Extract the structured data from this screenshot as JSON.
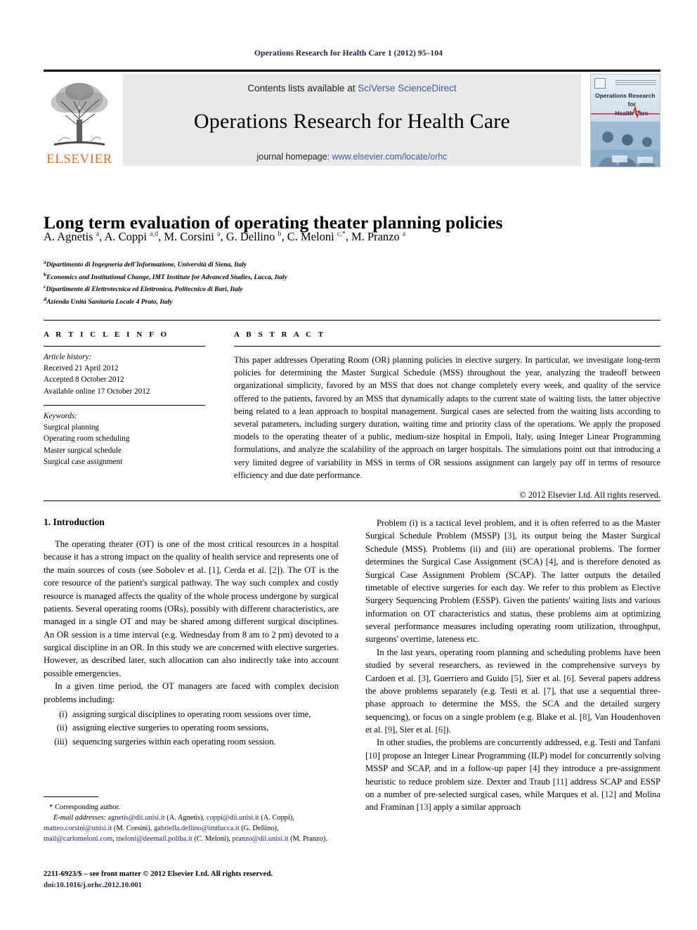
{
  "running_head": "Operations Research for Health Care 1 (2012) 95–104",
  "masthead": {
    "contents_prefix": "Contents lists available at ",
    "sciencedirect_link": "SciVerse ScienceDirect",
    "journal_title": "Operations Research for Health Care",
    "homepage_prefix": "journal homepage: ",
    "homepage_link": "www.elsevier.com/locate/orhc",
    "publisher_wordmark": "ELSEVIER",
    "cover": {
      "line1": "Operations Research",
      "line2": "for",
      "line3": "Health Care"
    }
  },
  "article": {
    "title": "Long term evaluation of operating theater planning policies",
    "authors_html": "A. Agnetis <sup>a</sup>, A. Coppi <sup>a,d</sup>, M. Corsini <sup>a</sup>, G. Dellino <sup>b</sup>, C. Meloni <sup>c,*</sup>, M. Pranzo <sup>a</sup>",
    "affiliations": [
      {
        "marker": "a",
        "text": "Dipartimento di Ingegneria dell'Informazione, Università di Siena, Italy"
      },
      {
        "marker": "b",
        "text": "Economics and Institutional Change, IMT Institute for Advanced Studies, Lucca, Italy"
      },
      {
        "marker": "c",
        "text": "Dipartimento di Elettrotecnica ed Elettronica, Politecnico di Bari, Italy"
      },
      {
        "marker": "d",
        "text": "Azienda Unità Sanitaria Locale 4 Prato, Italy"
      }
    ]
  },
  "article_info": {
    "heading": "A R T I C L E   I N F O",
    "history_label": "Article history:",
    "history": [
      "Received 21 April 2012",
      "Accepted 8 October 2012",
      "Available online 17 October 2012"
    ],
    "keywords_label": "Keywords:",
    "keywords": [
      "Surgical planning",
      "Operating room scheduling",
      "Master surgical schedule",
      "Surgical case assignment"
    ]
  },
  "abstract": {
    "heading": "A B S T R A C T",
    "text": "This paper addresses Operating Room (OR) planning policies in elective surgery. In particular, we investigate long-term policies for determining the Master Surgical Schedule (MSS) throughout the year, analyzing the tradeoff between organizational simplicity, favored by an MSS that does not change completely every week, and quality of the service offered to the patients, favored by an MSS that dynamically adapts to the current state of waiting lists, the latter objective being related to a lean approach to hospital management. Surgical cases are selected from the waiting lists according to several parameters, including surgery duration, waiting time and priority class of the operations. We apply the proposed models to the operating theater of a public, medium-size hospital in Empoli, Italy, using Integer Linear Programming formulations, and analyze the scalability of the approach on larger hospitals. The simulations point out that introducing a very limited degree of variability in MSS in terms of OR sessions assignment can largely pay off in terms of resource efficiency and due date performance.",
    "copyright": "© 2012 Elsevier Ltd. All rights reserved."
  },
  "body": {
    "section_heading": "1. Introduction",
    "left_paragraphs": [
      "The operating theater (OT) is one of the most critical resources in a hospital because it has a strong impact on the quality of health service and represents one of the main sources of costs (see Sobolev et al. [1], Cerda et al. [2]). The OT is the core resource of the patient's surgical pathway. The way such complex and costly resource is managed affects the quality of the whole process undergone by surgical patients. Several operating rooms (ORs), possibly with different characteristics, are managed in a single OT and may be shared among different surgical disciplines. An OR session is a time interval (e.g. Wednesday from 8 am to 2 pm) devoted to a surgical discipline in an OR. In this study we are concerned with elective surgeries. However, as described later, such allocation can also indirectly take into account possible emergencies.",
      "In a given time period, the OT managers are faced with complex decision problems including:"
    ],
    "problem_list": [
      {
        "num": "(i)",
        "text": "assigning surgical disciplines to operating room sessions over time,"
      },
      {
        "num": "(ii)",
        "text": "assigning elective surgeries to operating room sessions,"
      },
      {
        "num": "(iii)",
        "text": "sequencing surgeries within each operating room session."
      }
    ],
    "right_paragraphs": [
      "Problem (i) is a tactical level problem, and it is often referred to as the Master Surgical Schedule Problem (MSSP) [3], its output being the Master Surgical Schedule (MSS). Problems (ii) and (iii) are operational problems. The former determines the Surgical Case Assignment (SCA) [4], and is therefore denoted as Surgical Case Assignment Problem (SCAP). The latter outputs the detailed timetable of elective surgeries for each day. We refer to this problem as Elective Surgery Sequencing Problem (ESSP). Given the patients' waiting lists and various information on OT characteristics and status, these problems aim at optimizing several performance measures including operating room utilization, throughput, surgeons' overtime, lateness etc.",
      "In the last years, operating room planning and scheduling problems have been studied by several researchers, as reviewed in the comprehensive surveys by Cardoen et al. [3], Guerriero and Guido [5], Sier et al. [6]. Several papers address the above problems separately (e.g. Testi et al. [7], that use a sequential three-phase approach to determine the MSS, the SCA and the detailed surgery sequencing), or focus on a single problem (e.g. Blake et al. [8], Van Houdenhoven et al. [9], Sier et al. [6]).",
      "In other studies, the problems are concurrently addressed, e.g. Testi and Tanfani [10] propose an Integer Linear Programming (ILP) model for concurrently solving MSSP and SCAP, and in a follow-up paper [4] they introduce a pre-assignment heuristic to reduce problem size. Dexter and Traub [11] address SCAP and ESSP on a number of pre-selected surgical cases, while Marques et al. [12] and Molina and Framinan [13] apply a similar approach"
    ]
  },
  "footnote": {
    "star": "*",
    "corresponding": "Corresponding author.",
    "email_label": "E-mail addresses:",
    "emails": [
      {
        "addr": "agnetis@dii.unisi.it",
        "who": " (A. Agnetis), "
      },
      {
        "addr": "coppi@dii.unisi.it",
        "who": " (A. Coppi), "
      },
      {
        "addr": "matteo.corsini@unisi.it",
        "who": " (M. Corsini), "
      },
      {
        "addr": "gabriella.dellino@imtlucca.it",
        "who": " (G. Dellino), "
      },
      {
        "addr": "mail@carlomeloni.com",
        "who": ", "
      },
      {
        "addr": "meloni@deemail.poliba.it",
        "who": " (C. Meloni), "
      },
      {
        "addr": "pranzo@dii.unisi.it",
        "who": " (M. Pranzo)."
      }
    ]
  },
  "imprint": {
    "line1": "2211-6923/$ – see front matter © 2012 Elsevier Ltd. All rights reserved.",
    "doi": "doi:10.1016/j.orhc.2012.10.001"
  },
  "colors": {
    "link_blue": "#3b5ca8",
    "ref_navy": "#16215c",
    "elsevier_orange": "#E9711C",
    "band_gray": "#e9e9e9"
  }
}
